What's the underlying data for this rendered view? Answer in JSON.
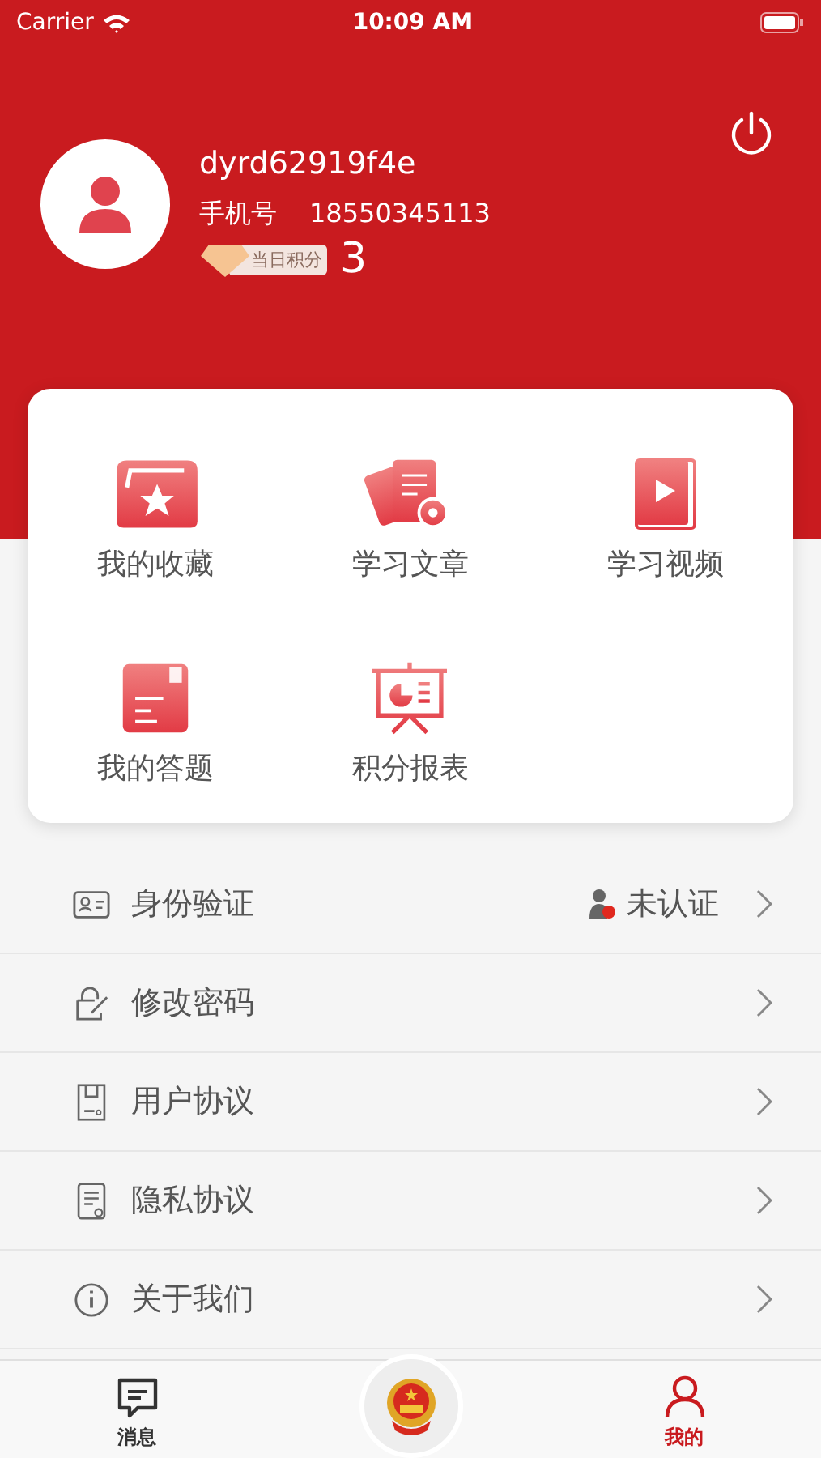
{
  "status_bar": {
    "carrier": "Carrier",
    "time": "10:09 AM"
  },
  "profile": {
    "username": "dyrd62919f4e",
    "phone_label": "手机号",
    "phone": "18550345113",
    "points_badge": "当日积分",
    "points": "3"
  },
  "shortcuts": [
    {
      "kind": "favorites",
      "label": "我的收藏"
    },
    {
      "kind": "articles",
      "label": "学习文章"
    },
    {
      "kind": "videos",
      "label": "学习视频"
    },
    {
      "kind": "answers",
      "label": "我的答题"
    },
    {
      "kind": "report",
      "label": "积分报表"
    }
  ],
  "menu": [
    {
      "kind": "identity",
      "label": "身份验证",
      "status": "未认证"
    },
    {
      "kind": "password",
      "label": "修改密码"
    },
    {
      "kind": "agreement",
      "label": "用户协议"
    },
    {
      "kind": "privacy",
      "label": "隐私协议"
    },
    {
      "kind": "about",
      "label": "关于我们"
    }
  ],
  "tab_bar": [
    {
      "kind": "message",
      "label": "消息",
      "selected": false
    },
    {
      "kind": "emblem",
      "selected": false
    },
    {
      "kind": "profile",
      "label": "我的",
      "selected": true
    }
  ]
}
